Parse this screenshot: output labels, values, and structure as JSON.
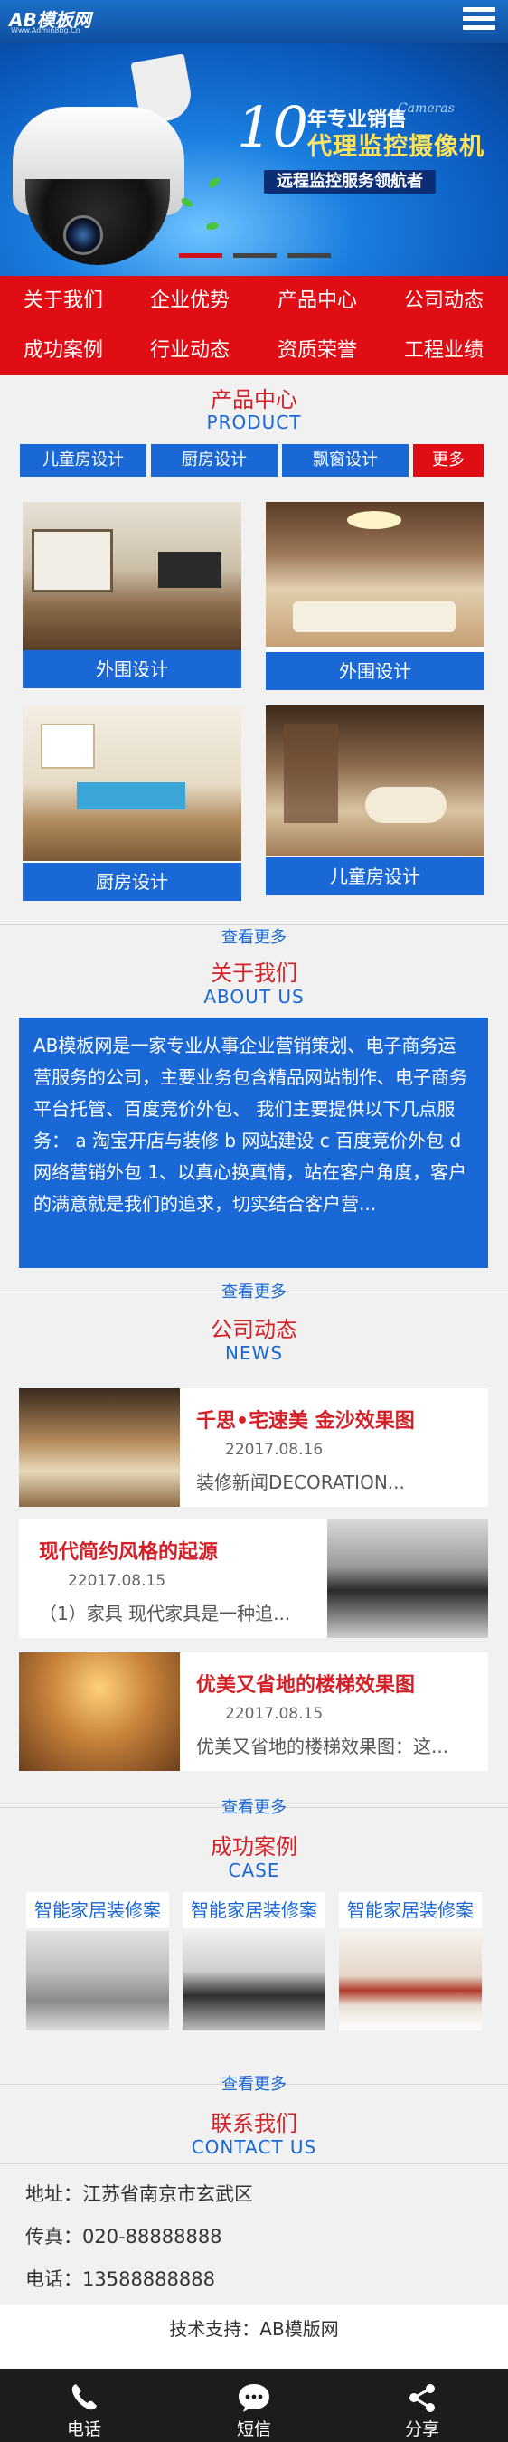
{
  "header": {
    "logo_text": "AB模板网",
    "logo_sub": "Www.Admin8bg.Cn"
  },
  "banner": {
    "number": "10",
    "line1": "年专业销售",
    "line1_en": "Cameras",
    "line2": "代理监控摄像机",
    "line3": "远程监控服务领航者"
  },
  "nav": {
    "items": [
      "关于我们",
      "企业优势",
      "产品中心",
      "公司动态",
      "成功案例",
      "行业动态",
      "资质荣誉",
      "工程业绩"
    ]
  },
  "products": {
    "title": "产品中心",
    "subtitle": "PRODUCT",
    "tabs": [
      "儿童房设计",
      "厨房设计",
      "飘窗设计"
    ],
    "more_tab": "更多",
    "items": [
      "外围设计",
      "外围设计",
      "厨房设计",
      "儿童房设计"
    ],
    "more_link": "查看更多"
  },
  "about": {
    "title": "关于我们",
    "subtitle": "ABOUT US",
    "text": "AB模板网是一家专业从事企业营销策划、电子商务运营服务的公司，主要业务包含精品网站制作、电子商务平台托管、百度竞价外包、 我们主要提供以下几点服务： a 淘宝开店与装修 b 网站建设 c 百度竞价外包 d 网络营销外包 1、以真心换真情，站在客户角度，客户的满意就是我们的追求，切实结合客户营...",
    "more_link": "查看更多"
  },
  "news": {
    "title": "公司动态",
    "subtitle": "NEWS",
    "items": [
      {
        "title": "千思•宅速美 金沙效果图",
        "date": "22017.08.16",
        "desc": "装修新闻DECORATION..."
      },
      {
        "title": "现代简约风格的起源",
        "date": "22017.08.15",
        "desc": "（1）家具 现代家具是一种追..."
      },
      {
        "title": "优美又省地的楼梯效果图",
        "date": "22017.08.15",
        "desc": "优美又省地的楼梯效果图：这..."
      }
    ],
    "more_link": "查看更多"
  },
  "cases": {
    "title": "成功案例",
    "subtitle": "CASE",
    "items": [
      "智能家居装修案",
      "智能家居装修案",
      "智能家居装修案"
    ],
    "more_link": "查看更多"
  },
  "contact": {
    "title": "联系我们",
    "subtitle": "CONTACT US",
    "address": "地址：江苏省南京市玄武区",
    "fax": "传真：020-88888888",
    "phone": "电话：13588888888"
  },
  "footer": {
    "tech": "技术支持：AB模版网"
  },
  "bottom_bar": {
    "items": [
      {
        "label": "电话",
        "icon": "phone-icon"
      },
      {
        "label": "短信",
        "icon": "sms-icon"
      },
      {
        "label": "分享",
        "icon": "share-icon"
      }
    ]
  },
  "colors": {
    "brand_blue": "#1968d6",
    "brand_red": "#e00d14",
    "title_red": "#d42128"
  }
}
